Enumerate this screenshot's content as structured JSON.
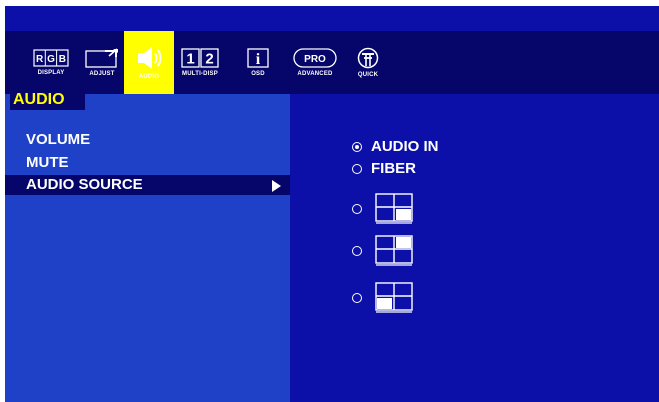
{
  "toolbar": {
    "items": [
      {
        "label": "DISPLAY",
        "icon": "rgb-icon",
        "glyph": [
          "R",
          "G",
          "B"
        ]
      },
      {
        "label": "ADJUST",
        "icon": "adjust-icon"
      },
      {
        "label": "AUDIO",
        "icon": "speaker-icon",
        "active": true
      },
      {
        "label": "MULTI-DISP",
        "icon": "multi-display-icon",
        "glyph": [
          "1",
          "2"
        ]
      },
      {
        "label": "OSD",
        "icon": "info-icon",
        "glyph": "i"
      },
      {
        "label": "ADVANCED",
        "icon": "pro-icon",
        "glyph": "PRO"
      },
      {
        "label": "QUICK",
        "icon": "quick-icon"
      }
    ],
    "colors": {
      "bar": "#05056a",
      "active": "#ffff00"
    }
  },
  "section": {
    "title": "AUDIO"
  },
  "menu": {
    "items": [
      {
        "label": "VOLUME"
      },
      {
        "label": "MUTE"
      },
      {
        "label": "AUDIO SOURCE",
        "selected": true
      }
    ]
  },
  "options": [
    {
      "label": "AUDIO IN",
      "selected": true,
      "icon": "radio-icon"
    },
    {
      "label": "FIBER",
      "selected": false,
      "icon": "radio-icon"
    },
    {
      "label": "",
      "selected": false,
      "icon": "pip-layout-bottom-right-icon"
    },
    {
      "label": "",
      "selected": false,
      "icon": "pip-layout-top-right-icon"
    },
    {
      "label": "",
      "selected": false,
      "icon": "pip-layout-bottom-left-icon"
    }
  ],
  "colors": {
    "background": "#0c10a8",
    "left_panel": "#1f41c8",
    "highlight": "#05056a",
    "title": "#ffff00"
  }
}
